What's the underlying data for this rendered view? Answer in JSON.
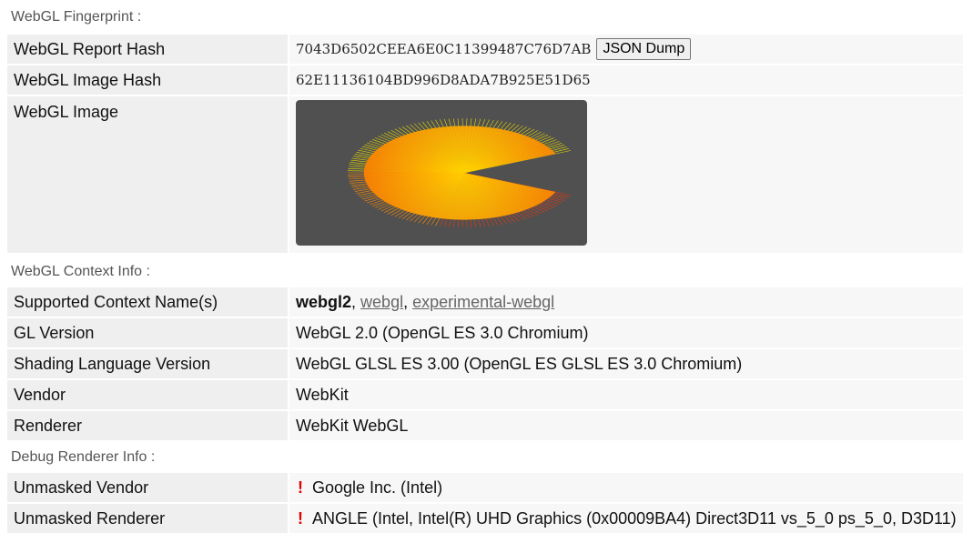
{
  "fingerprint": {
    "section_title": "WebGL Fingerprint :",
    "report_hash_label": "WebGL Report Hash",
    "report_hash_value": "7043D6502CEEA6E0C11399487C76D7AB",
    "json_dump_label": "JSON Dump",
    "image_hash_label": "WebGL Image Hash",
    "image_hash_value": "62E11136104BD996D8ADA7B925E51D65",
    "image_label": "WebGL Image",
    "image_colors": {
      "background": "#505050",
      "inner": "#ff9a00",
      "outer_top": "#e8e000",
      "outer_bottom": "#e02010"
    }
  },
  "context": {
    "section_title": "WebGL Context Info :",
    "rows": [
      {
        "label": "Supported Context Name(s)"
      },
      {
        "label": "GL Version",
        "value": "WebGL 2.0 (OpenGL ES 3.0 Chromium)"
      },
      {
        "label": "Shading Language Version",
        "value": "WebGL GLSL ES 3.00 (OpenGL ES GLSL ES 3.0 Chromium)"
      },
      {
        "label": "Vendor",
        "value": "WebKit"
      },
      {
        "label": "Renderer",
        "value": "WebKit WebGL"
      }
    ],
    "supported_contexts": {
      "active": "webgl2",
      "others": [
        "webgl",
        "experimental-webgl"
      ],
      "separator": ","
    }
  },
  "debug": {
    "section_title": "Debug Renderer Info :",
    "warn_mark": "!",
    "rows": [
      {
        "label": "Unmasked Vendor",
        "value": "Google Inc. (Intel)"
      },
      {
        "label": "Unmasked Renderer",
        "value": "ANGLE (Intel, Intel(R) UHD Graphics (0x00009BA4) Direct3D11 vs_5_0 ps_5_0, D3D11)"
      }
    ]
  }
}
